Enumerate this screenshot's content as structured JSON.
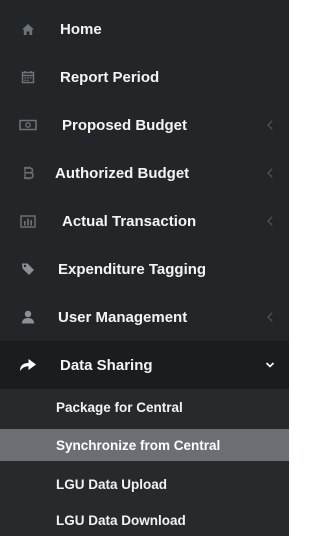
{
  "sidebar": {
    "items": [
      {
        "label": "Home",
        "icon": "home-icon",
        "has_chevron": false
      },
      {
        "label": "Report Period",
        "icon": "calendar-icon",
        "has_chevron": false
      },
      {
        "label": "Proposed Budget",
        "icon": "money-icon",
        "has_chevron": true
      },
      {
        "label": "Authorized Budget",
        "icon": "bitcoin-icon",
        "has_chevron": true
      },
      {
        "label": "Actual Transaction",
        "icon": "bar-chart-icon",
        "has_chevron": true
      },
      {
        "label": "Expenditure Tagging",
        "icon": "tag-icon",
        "has_chevron": false
      },
      {
        "label": "User Management",
        "icon": "user-icon",
        "has_chevron": true
      },
      {
        "label": "Data Sharing",
        "icon": "share-icon",
        "has_chevron": true,
        "expanded": true
      }
    ],
    "submenu": [
      {
        "label": "Package for Central"
      },
      {
        "label": "Synchronize from Central",
        "highlighted": true
      },
      {
        "label": "LGU Data Upload"
      },
      {
        "label": "LGU Data Download"
      }
    ]
  },
  "colors": {
    "sidebar_bg": "#232629",
    "active_bg": "#1a1c1e",
    "submenu_bg": "#27292c",
    "highlight_bg": "#6b6e72",
    "icon_muted": "#6c7378",
    "text": "#f4f4f4"
  }
}
